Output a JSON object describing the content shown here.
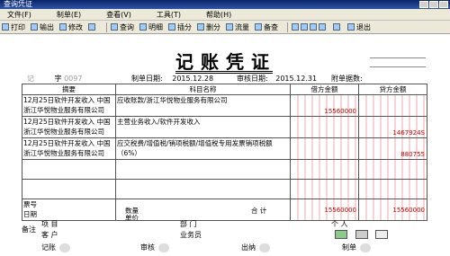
{
  "window": {
    "title": "查询凭证"
  },
  "menu": [
    "文件(F)",
    "制单(E)",
    "查看(V)",
    "工具(T)",
    "帮助(H)"
  ],
  "toolbar": [
    "打印",
    "输出",
    "修改",
    "",
    "查询",
    "明细",
    "插分",
    "删分",
    "流量",
    "备查",
    "",
    "退出"
  ],
  "voucher": {
    "title": "记账凭证",
    "prefix": "记",
    "number_label": "字",
    "number": "0097",
    "date_label": "制单日期:",
    "date": "2015.12.28",
    "audit_label": "审核日期:",
    "audit_date": "2015.12.31",
    "attach_label": "附单据数:",
    "headers": {
      "summary": "摘要",
      "account": "科目名称",
      "debit": "借方金额",
      "credit": "贷方金额"
    },
    "rows": [
      {
        "summary": "12月25日软件开发收入 中国 浙江华悦物业服务有限公司",
        "account": "应收账款/浙江华悦物业服务有限公司",
        "debit": "15560000",
        "credit": ""
      },
      {
        "summary": "12月25日软件开发收入 中国 浙江华悦物业服务有限公司",
        "account": "主营业务收入/软件开发收入",
        "debit": "",
        "credit": "1467924S"
      },
      {
        "summary": "12月25日软件开发收入 中国 浙江华悦物业服务有限公司",
        "account": "应交税费/增值税/销项税额/增值税专用发票销项税额（6%）",
        "debit": "",
        "credit": "880755"
      }
    ],
    "footer": {
      "bill_no": "票号",
      "date": "日期",
      "quantity": "数量",
      "unit_price": "单价",
      "total": "合 计",
      "total_debit": "15560000",
      "total_credit": "15560000",
      "remark": "备注",
      "project": "项 目",
      "customer": "客 户",
      "dept": "部 门",
      "clerk": "业务员",
      "person": "个 人"
    },
    "sign": {
      "bookkeeper": "记账",
      "auditor": "审核",
      "cashier": "出纳",
      "maker": "制单"
    }
  }
}
